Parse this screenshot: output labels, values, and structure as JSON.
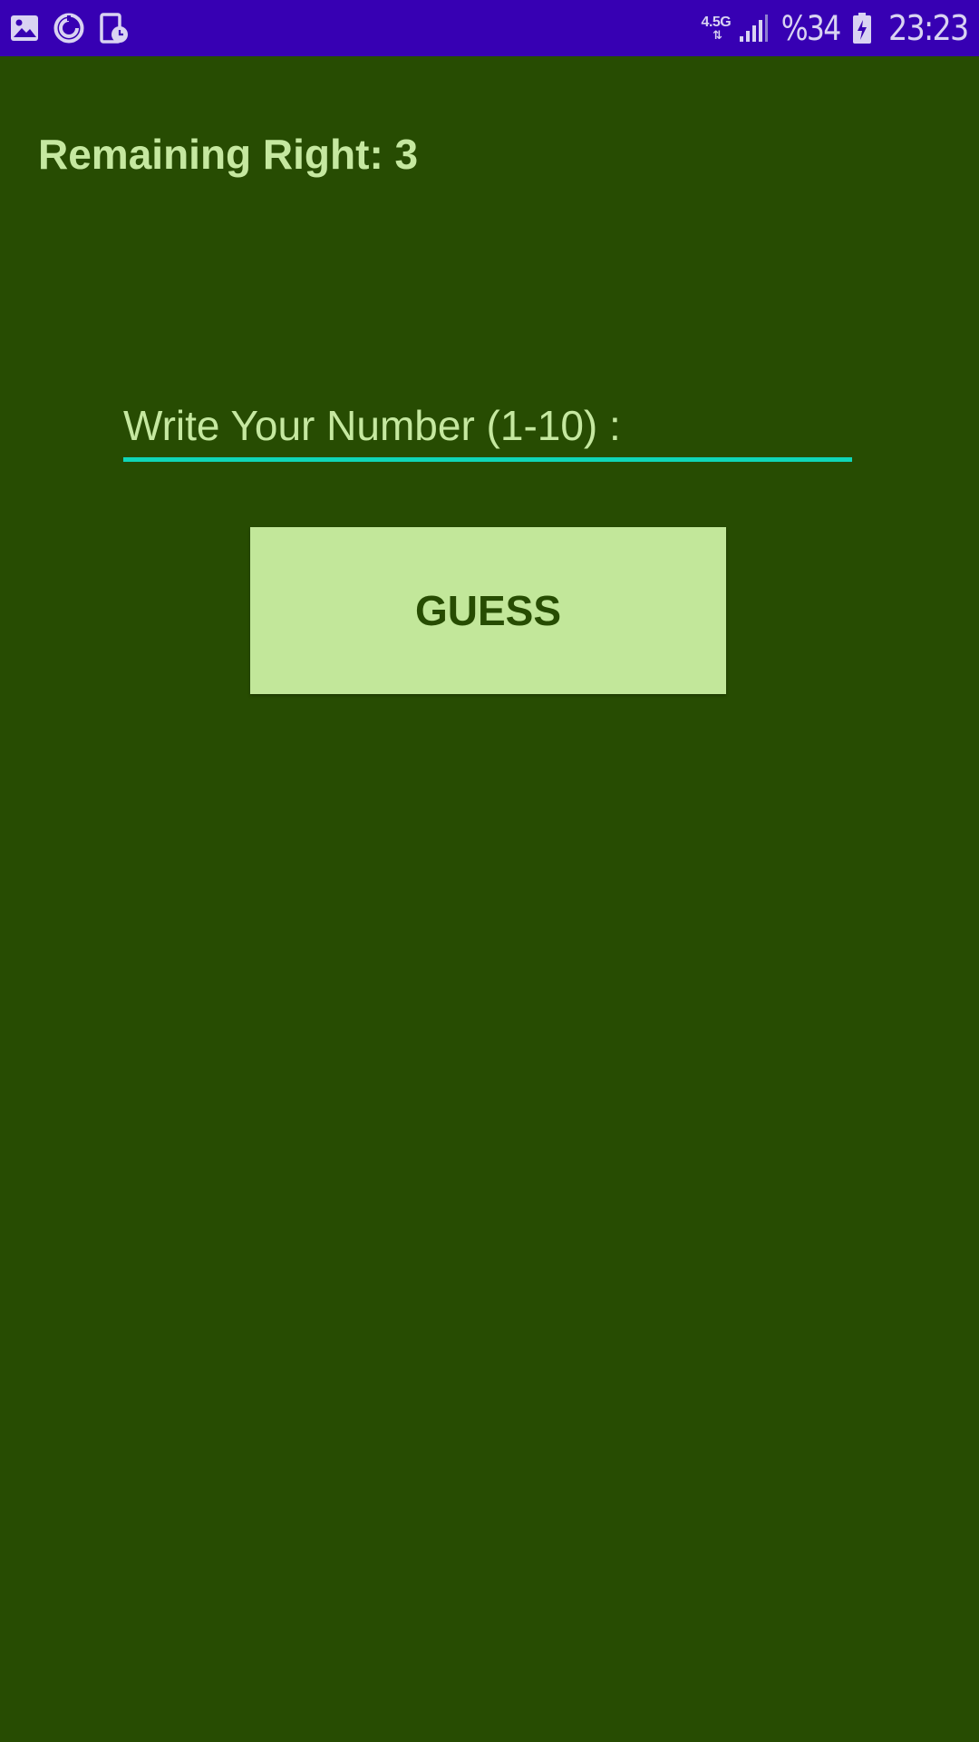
{
  "status_bar": {
    "left_icons": [
      "image-icon",
      "sync-icon",
      "screen-timer-icon"
    ],
    "network_type": "4.5G",
    "network_arrows": "⇅",
    "signal_icon": "signal-bars-icon",
    "battery_percent": "%34",
    "battery_icon": "battery-charging-icon",
    "time": "23:23",
    "background_color": "#3700b3"
  },
  "game": {
    "remaining_label": "Remaining Right: 3",
    "input_placeholder": "Write Your Number (1-10) :",
    "input_value": "",
    "guess_button_label": "GUESS"
  },
  "colors": {
    "background": "#274c02",
    "text": "#c5e8a0",
    "button_background": "#c2e79a",
    "input_underline": "#0fd6b8"
  }
}
